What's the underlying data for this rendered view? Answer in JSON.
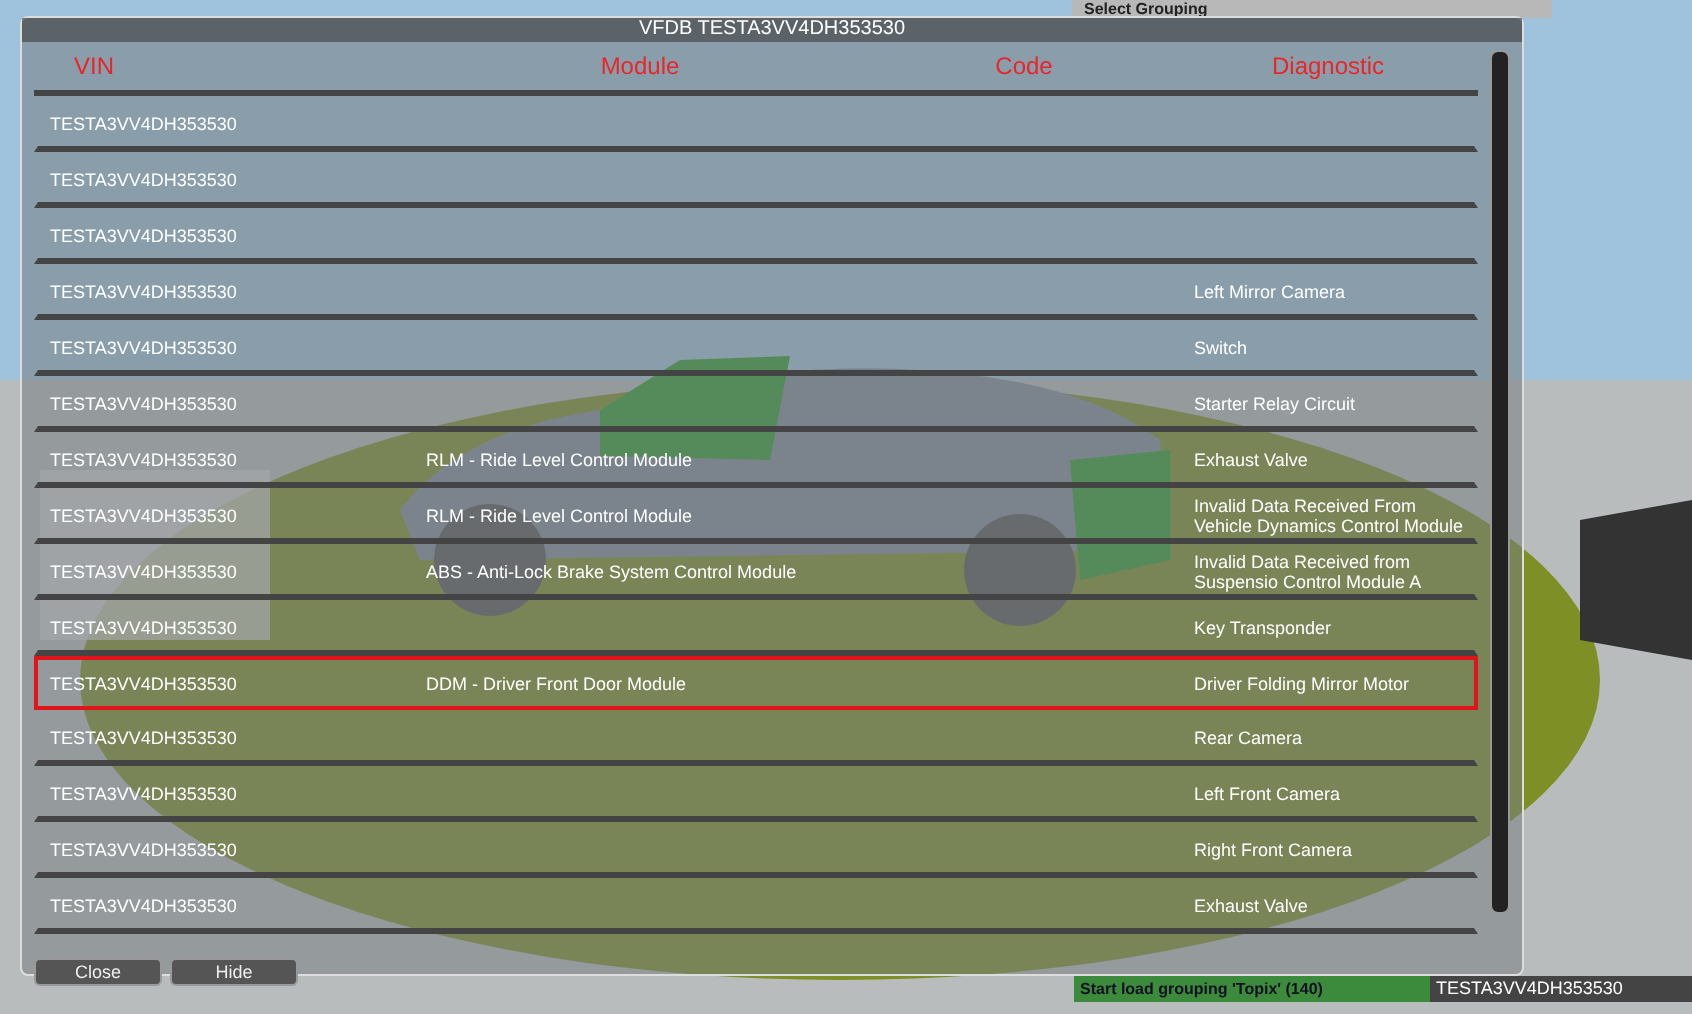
{
  "top_bar": {
    "label": "Select Grouping"
  },
  "window": {
    "title": "VFDB TESTA3VV4DH353530"
  },
  "table": {
    "columns": [
      "VIN",
      "Module",
      "Code",
      "Diagnostic"
    ],
    "rows": [
      {
        "vin": "TESTA3VV4DH353530",
        "selected": false
      },
      {
        "vin": "TESTA3VV4DH353530",
        "selected": false
      },
      {
        "vin": "TESTA3VV4DH353530",
        "selected": false
      },
      {
        "vin": "TESTA3VV4DH353530",
        "diagnostic": "Left Mirror Camera",
        "selected": false
      },
      {
        "vin": "TESTA3VV4DH353530",
        "diagnostic": "Switch",
        "selected": false
      },
      {
        "vin": "TESTA3VV4DH353530",
        "diagnostic": "Starter Relay Circuit",
        "selected": false
      },
      {
        "vin": "TESTA3VV4DH353530",
        "module": "RLM - Ride Level Control Module",
        "diagnostic": "Exhaust Valve",
        "selected": false
      },
      {
        "vin": "TESTA3VV4DH353530",
        "module": "RLM - Ride Level Control Module",
        "diagnostic": "Invalid Data Received From  Vehicle Dynamics Control Module",
        "selected": false
      },
      {
        "vin": "TESTA3VV4DH353530",
        "module": "ABS - Anti-Lock Brake System Control Module",
        "diagnostic": "Invalid Data Received from Suspensio Control Module A",
        "selected": false
      },
      {
        "vin": "TESTA3VV4DH353530",
        "diagnostic": "Key Transponder",
        "selected": false
      },
      {
        "vin": "TESTA3VV4DH353530",
        "module": "DDM - Driver Front Door Module",
        "diagnostic": "Driver Folding Mirror Motor",
        "selected": true
      },
      {
        "vin": "TESTA3VV4DH353530",
        "diagnostic": "Rear Camera",
        "selected": false
      },
      {
        "vin": "TESTA3VV4DH353530",
        "diagnostic": "Left Front Camera",
        "selected": false
      },
      {
        "vin": "TESTA3VV4DH353530",
        "diagnostic": "Right Front Camera",
        "selected": false
      },
      {
        "vin": "TESTA3VV4DH353530",
        "diagnostic": "Exhaust Valve",
        "selected": false
      }
    ]
  },
  "buttons": [
    "Close",
    "Hide"
  ],
  "status_bar": {
    "message": "Start load grouping 'Topix' (140)",
    "vin": "TESTA3VV4DH353530"
  }
}
